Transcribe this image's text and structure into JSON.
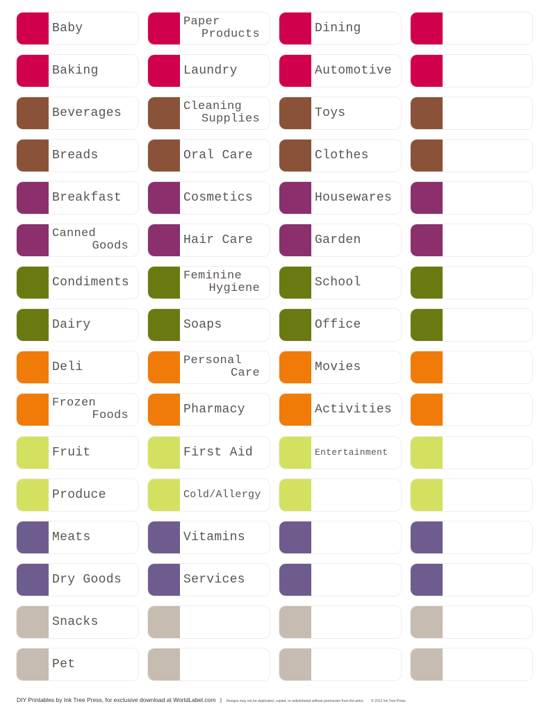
{
  "row_colors": [
    "#d1004c",
    "#d1004c",
    "#8a5238",
    "#8a5238",
    "#8b2f6d",
    "#8b2f6d",
    "#6b7a10",
    "#6b7a10",
    "#f07b08",
    "#f07b08",
    "#d4e160",
    "#d4e160",
    "#6e5c8e",
    "#6e5c8e",
    "#c6bcb1",
    "#c6bcb1"
  ],
  "columns": [
    [
      "Baby",
      "Baking",
      "Beverages",
      "Breads",
      "Breakfast",
      [
        "Canned",
        "Goods"
      ],
      "Condiments",
      "Dairy",
      "Deli",
      [
        "Frozen",
        "Foods"
      ],
      "Fruit",
      "Produce",
      "Meats",
      "Dry Goods",
      "Snacks",
      "Pet"
    ],
    [
      [
        "Paper",
        "Products"
      ],
      "Laundry",
      [
        "Cleaning",
        "Supplies"
      ],
      "Oral Care",
      "Cosmetics",
      "Hair Care",
      [
        "Feminine",
        "Hygiene"
      ],
      "Soaps",
      [
        "Personal",
        "Care"
      ],
      "Pharmacy",
      "First Aid",
      "Cold/Allergy",
      "Vitamins",
      "Services",
      "",
      ""
    ],
    [
      "Dining",
      "Automotive",
      "Toys",
      "Clothes",
      "Housewares",
      "Garden",
      "School",
      "Office",
      "Movies",
      "Activities",
      "Entertainment",
      "",
      "",
      "",
      "",
      ""
    ],
    [
      "",
      "",
      "",
      "",
      "",
      "",
      "",
      "",
      "",
      "",
      "",
      "",
      "",
      "",
      "",
      ""
    ]
  ],
  "footer": {
    "credit": "DIY Printables by Ink Tree Press, for exclusive download at WorldLabel.com",
    "separator": "|",
    "notice": "Designs may not be duplicated, copied, or redistributed without permission from the artist.",
    "copyright": "© 2012 Ink Tree Press"
  }
}
